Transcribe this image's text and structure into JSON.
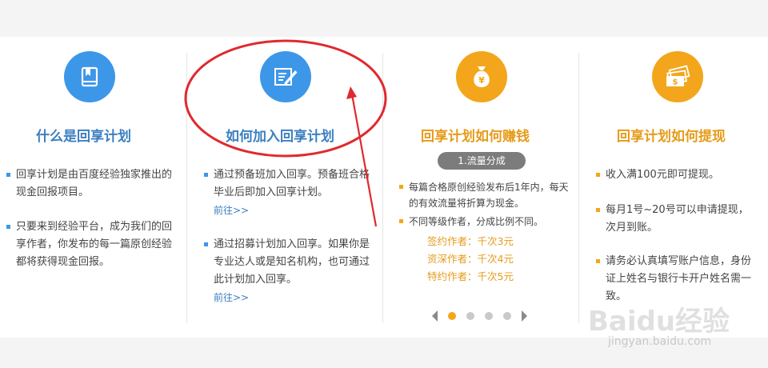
{
  "columns": [
    {
      "title": "什么是回享计划",
      "icon": "book-icon",
      "items": [
        "回享计划是由百度经验独家推出的现金回报项目。",
        "只要来到经验平台，成为我们的回享作者，你发布的每一篇原创经验都将获得现金回报。"
      ]
    },
    {
      "title": "如何加入回享计划",
      "icon": "document-pen-icon",
      "items": [
        {
          "text": "通过预备班加入回享。预备班合格毕业后即加入回享计划。",
          "link": "前往>>"
        },
        {
          "text": "通过招募计划加入回享。如果你是专业达人或是知名机构，也可通过此计划加入回享。",
          "link": "前往>>"
        }
      ]
    },
    {
      "title": "回享计划如何赚钱",
      "icon": "money-bag-icon",
      "pill": "1.流量分成",
      "items": [
        "每篇合格原创经验发布后1年内，每天的有效流量将折算为现金。",
        "不同等级作者，分成比例不同。"
      ],
      "grades": [
        "签约作者：千次3元",
        "资深作者：千次4元",
        "特约作者：千次5元"
      ]
    },
    {
      "title": "回享计划如何提现",
      "icon": "cash-icon",
      "items": [
        "收入满100元即可提现。",
        "每月1号~20号可以申请提现，次月到账。",
        "请务必认真填写账户信息，身份证上姓名与银行卡开户姓名需一致。"
      ]
    }
  ],
  "carousel": {
    "pages": 4,
    "active": 1
  },
  "watermark": {
    "brand": "Baidu经验",
    "url": "jingyan.baidu.com"
  },
  "colors": {
    "blue": "#3d97e8",
    "orange": "#f3a61b",
    "annotation": "#e0292e"
  }
}
